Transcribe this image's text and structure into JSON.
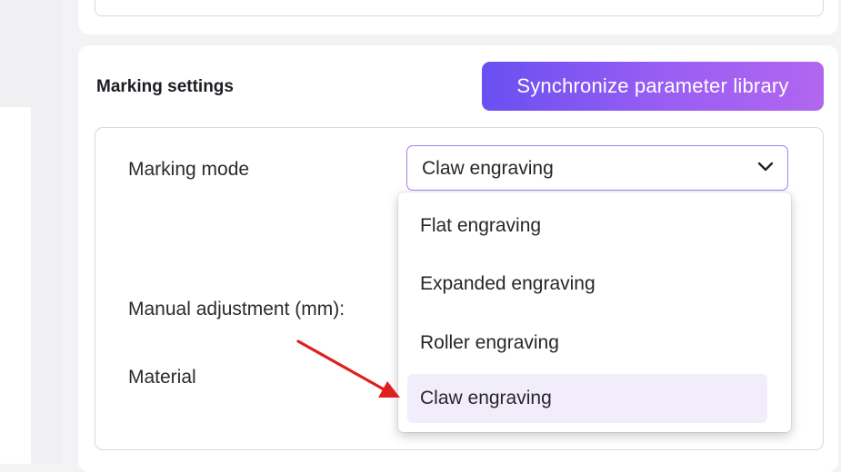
{
  "section": {
    "title": "Marking settings",
    "sync_button_label": "Synchronize parameter library"
  },
  "fields": {
    "marking_mode_label": "Marking mode",
    "manual_adjustment_label": "Manual adjustment (mm):",
    "material_label": "Material"
  },
  "marking_mode_select": {
    "selected": "Claw engraving",
    "open": true,
    "options": [
      {
        "label": "Flat engraving",
        "highlighted": false
      },
      {
        "label": "Expanded engraving",
        "highlighted": false
      },
      {
        "label": "Roller engraving",
        "highlighted": false
      },
      {
        "label": "Claw engraving",
        "highlighted": true
      }
    ]
  },
  "colors": {
    "accent_start": "#6a4ff2",
    "accent_end": "#b166ef",
    "select_border": "#a77ef0",
    "highlight_bg": "#f2edfb",
    "annotation_arrow": "#e02020"
  },
  "icons": {
    "select_indicator": "chevron-down-icon",
    "annotation": "red-arrow-icon"
  }
}
